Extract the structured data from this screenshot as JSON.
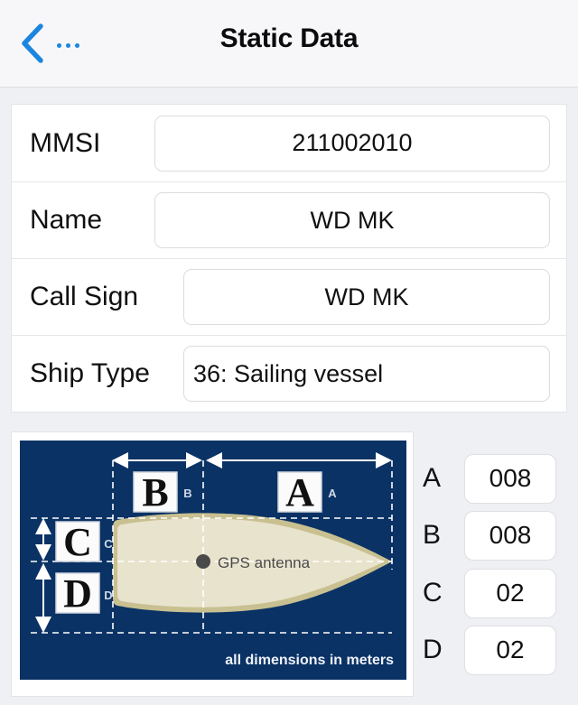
{
  "navbar": {
    "back_icon": "chevron-left-icon",
    "more_icon": "ellipsis-icon",
    "title": "Static Data"
  },
  "form": {
    "rows": [
      {
        "label": "MMSI",
        "value": "211002010",
        "align": "center"
      },
      {
        "label": "Name",
        "value": "WD MK",
        "align": "center"
      },
      {
        "label": "Call Sign",
        "value": "WD MK",
        "align": "center"
      },
      {
        "label": "Ship Type",
        "value": "36: Sailing vessel",
        "align": "left"
      }
    ]
  },
  "diagram": {
    "title_labels": {
      "a": "A",
      "b": "B",
      "c": "C",
      "d": "D"
    },
    "tick_labels": {
      "a": "A",
      "b": "B",
      "c": "C",
      "d": "D"
    },
    "antenna_label": "GPS antenna",
    "caption": "all dimensions in meters",
    "colors": {
      "background": "#0a3265",
      "hull": "#e8e3cc",
      "hull_edge": "#c9c091",
      "guide": "#ffffff",
      "antenna_dot": "#4a4a4a"
    }
  },
  "dimensions": {
    "rows": [
      {
        "label": "A",
        "value": "008"
      },
      {
        "label": "B",
        "value": "008"
      },
      {
        "label": "C",
        "value": "02"
      },
      {
        "label": "D",
        "value": "02"
      }
    ]
  }
}
